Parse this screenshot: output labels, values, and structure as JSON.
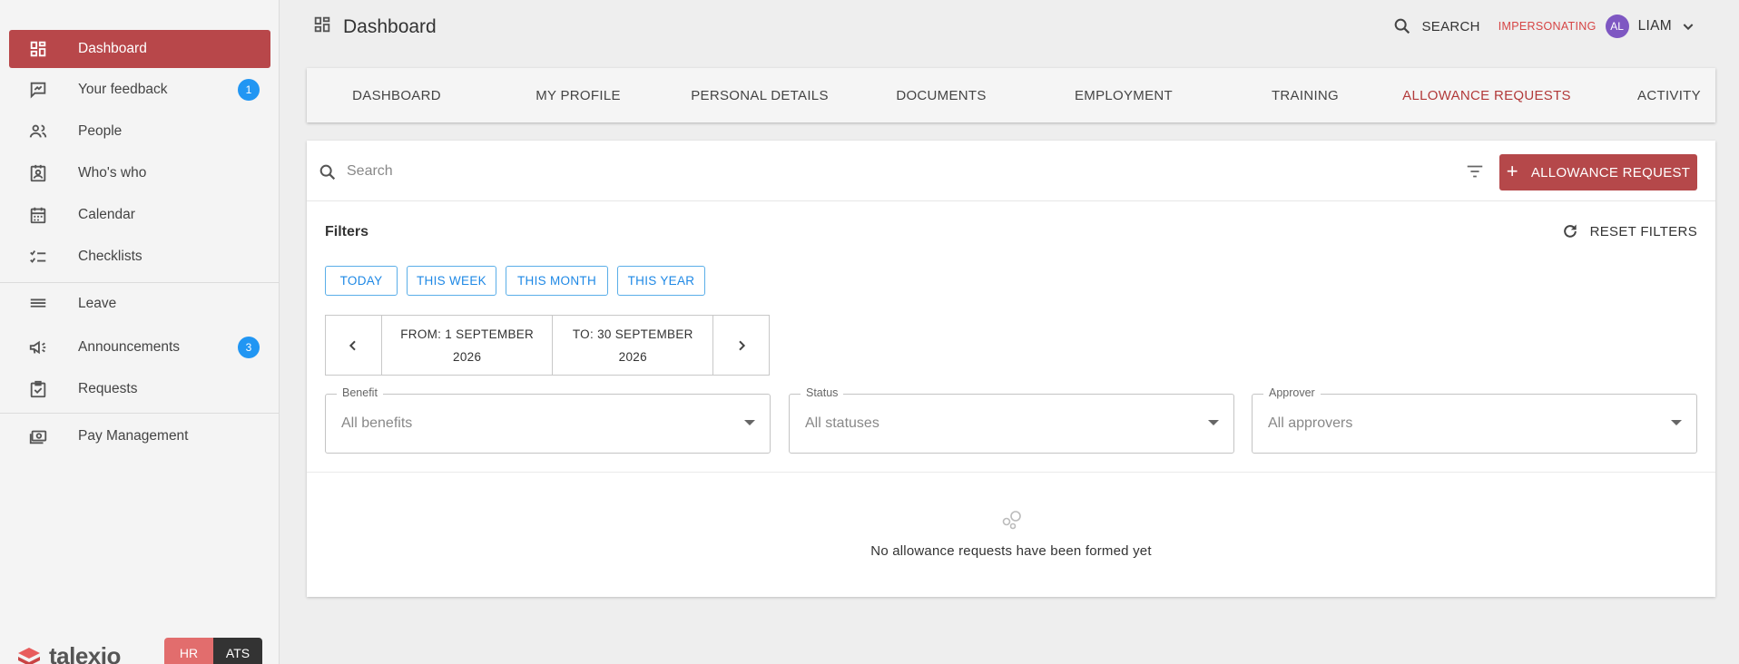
{
  "sidebar": {
    "items": [
      {
        "label": "Dashboard",
        "icon": "dashboard-icon"
      },
      {
        "label": "Your feedback",
        "icon": "feedback-icon",
        "badge": "1"
      },
      {
        "label": "People",
        "icon": "people-icon"
      },
      {
        "label": "Who's who",
        "icon": "badge-icon"
      },
      {
        "label": "Calendar",
        "icon": "calendar-icon"
      },
      {
        "label": "Checklists",
        "icon": "checklist-icon"
      },
      {
        "label": "Leave",
        "icon": "leave-icon"
      },
      {
        "label": "Announcements",
        "icon": "megaphone-icon",
        "badge": "3"
      },
      {
        "label": "Requests",
        "icon": "requests-icon"
      },
      {
        "label": "Pay Management",
        "icon": "payment-icon"
      }
    ],
    "brand": "talexio",
    "toggle": {
      "hr": "HR",
      "ats": "ATS"
    }
  },
  "header": {
    "title": "Dashboard",
    "search_label": "SEARCH",
    "impersonating": "IMPERSONATING",
    "avatar_initials": "AL",
    "user_name": "LIAM"
  },
  "tabs": [
    "DASHBOARD",
    "MY PROFILE",
    "PERSONAL DETAILS",
    "DOCUMENTS",
    "EMPLOYMENT",
    "TRAINING",
    "ALLOWANCE REQUESTS",
    "ACTIVITY"
  ],
  "active_tab": "ALLOWANCE REQUESTS",
  "main": {
    "search_placeholder": "Search",
    "add_button": "ALLOWANCE REQUEST",
    "filters_title": "Filters",
    "reset_filters": "RESET FILTERS",
    "quick_filters": [
      "TODAY",
      "THIS WEEK",
      "THIS MONTH",
      "THIS YEAR"
    ],
    "range": {
      "from_line1": "FROM: 1 SEPTEMBER",
      "from_line2": "2026",
      "to_line1": "TO: 30 SEPTEMBER",
      "to_line2": "2026"
    },
    "selects": [
      {
        "label": "Benefit",
        "value": "All benefits"
      },
      {
        "label": "Status",
        "value": "All statuses"
      },
      {
        "label": "Approver",
        "value": "All approvers"
      }
    ],
    "empty_message": "No allowance requests have been formed yet"
  },
  "colors": {
    "accent": "#b5484a",
    "active_tab": "#b23a3a",
    "badge": "#2196f3",
    "avatar": "#7e57c2",
    "link": "#1e88e5"
  }
}
